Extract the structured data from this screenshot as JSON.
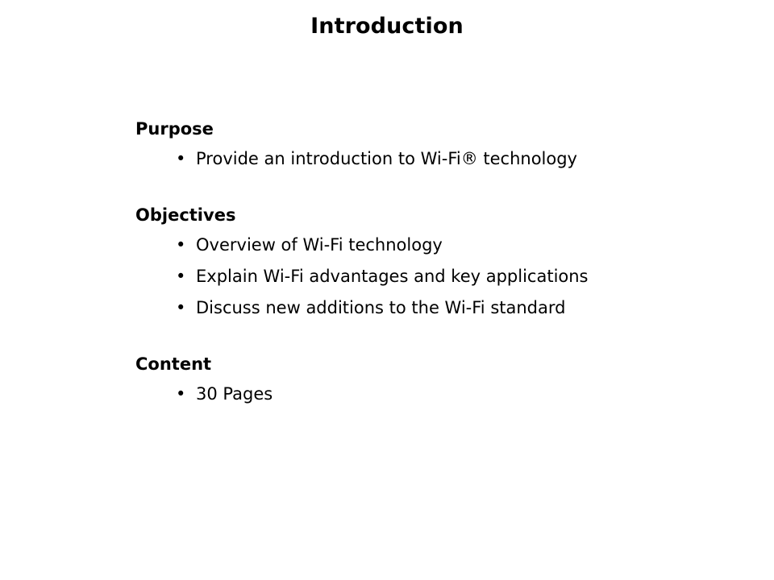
{
  "slide": {
    "title": "Introduction",
    "background_color": "#ffffff",
    "text_color": "#000000",
    "bullet_glyph": "•",
    "sections": [
      {
        "heading": "Purpose",
        "bullets": [
          "Provide an introduction to Wi-Fi® technology"
        ]
      },
      {
        "heading": "Objectives",
        "bullets": [
          "Overview of Wi-Fi technology",
          "Explain Wi-Fi advantages and key applications",
          "Discuss new additions to the Wi-Fi standard"
        ]
      },
      {
        "heading": "Content",
        "bullets": [
          "30 Pages"
        ]
      }
    ]
  }
}
